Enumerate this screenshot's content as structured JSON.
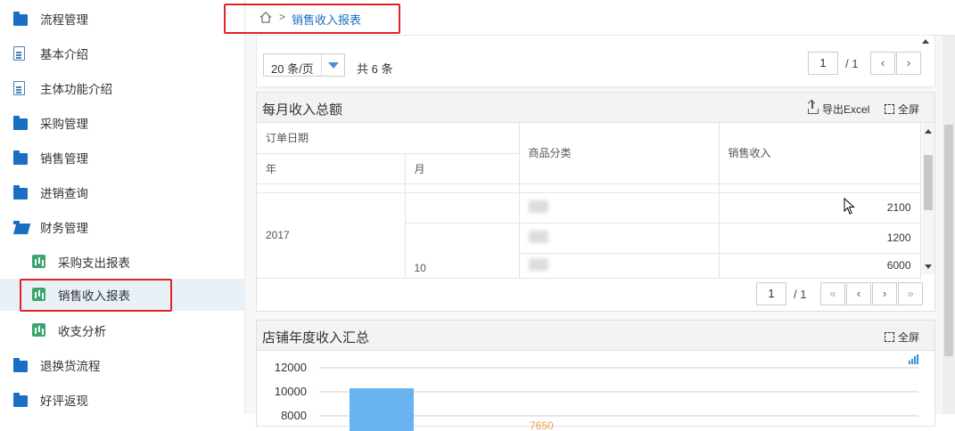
{
  "sidebar": {
    "items": [
      {
        "label": "流程管理",
        "icon": "folder-icon"
      },
      {
        "label": "基本介绍",
        "icon": "document-icon"
      },
      {
        "label": "主体功能介绍",
        "icon": "document-icon"
      },
      {
        "label": "采购管理",
        "icon": "folder-icon"
      },
      {
        "label": "销售管理",
        "icon": "folder-icon"
      },
      {
        "label": "进销查询",
        "icon": "folder-icon"
      },
      {
        "label": "财务管理",
        "icon": "folder-open-icon"
      },
      {
        "label": "采购支出报表",
        "icon": "chart-icon"
      },
      {
        "label": "销售收入报表",
        "icon": "chart-icon",
        "active": true
      },
      {
        "label": "收支分析",
        "icon": "chart-icon"
      },
      {
        "label": "退换货流程",
        "icon": "folder-icon"
      },
      {
        "label": "好评返现",
        "icon": "folder-icon"
      }
    ]
  },
  "breadcrumb": {
    "separator": ">",
    "current": "销售收入报表"
  },
  "top_pager": {
    "page_size": "20 条/页",
    "total": "共 6 条",
    "page": "1",
    "page_total": "/ 1",
    "prev": "‹",
    "next": "›"
  },
  "monthly_panel": {
    "title": "每月收入总额",
    "export_label": "导出Excel",
    "fullscreen_label": "全屏",
    "headers": {
      "order_date": "订单日期",
      "year": "年",
      "month": "月",
      "category": "商品分类",
      "revenue": "销售收入"
    },
    "year": "2017",
    "month": "10",
    "revenues": [
      "2100",
      "1200",
      "6000"
    ],
    "pager": {
      "page": "1",
      "page_total": "/ 1",
      "first": "«",
      "prev": "‹",
      "next": "›",
      "last": "»"
    }
  },
  "annual_panel": {
    "title": "店铺年度收入汇总",
    "fullscreen_label": "全屏"
  },
  "chart_data": {
    "type": "bar",
    "y_ticks": [
      "12000",
      "10000",
      "8000"
    ],
    "ylim": [
      8000,
      12000
    ],
    "values": [
      10300
    ],
    "data_labels": [
      "7650"
    ],
    "bar_color": "#69b4f0",
    "label_color": "#f0a040"
  },
  "colors": {
    "accent": "#1a6fc4",
    "highlight": "#e02424",
    "active_bg": "#e8f1f8"
  }
}
